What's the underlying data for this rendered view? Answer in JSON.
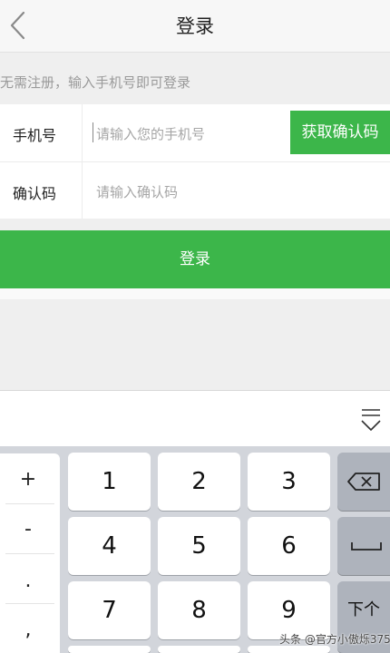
{
  "header": {
    "title": "登录"
  },
  "hint": "无需注册，输入手机号即可登录",
  "form": {
    "phone_label": "手机号",
    "phone_placeholder": "请输入您的手机号",
    "get_code_label": "获取确认码",
    "code_label": "确认码",
    "code_placeholder": "请输入确认码"
  },
  "login_button": "登录",
  "keyboard": {
    "symbols": [
      "+",
      "-",
      ".",
      ","
    ],
    "keys": [
      "1",
      "2",
      "3",
      "4",
      "5",
      "6",
      "7",
      "8",
      "9"
    ],
    "next_label": "下个"
  },
  "watermark": "头条 @官方小傲烁375",
  "colors": {
    "accent_green": "#3cb64a",
    "keyboard_bg": "#d2d5db"
  }
}
